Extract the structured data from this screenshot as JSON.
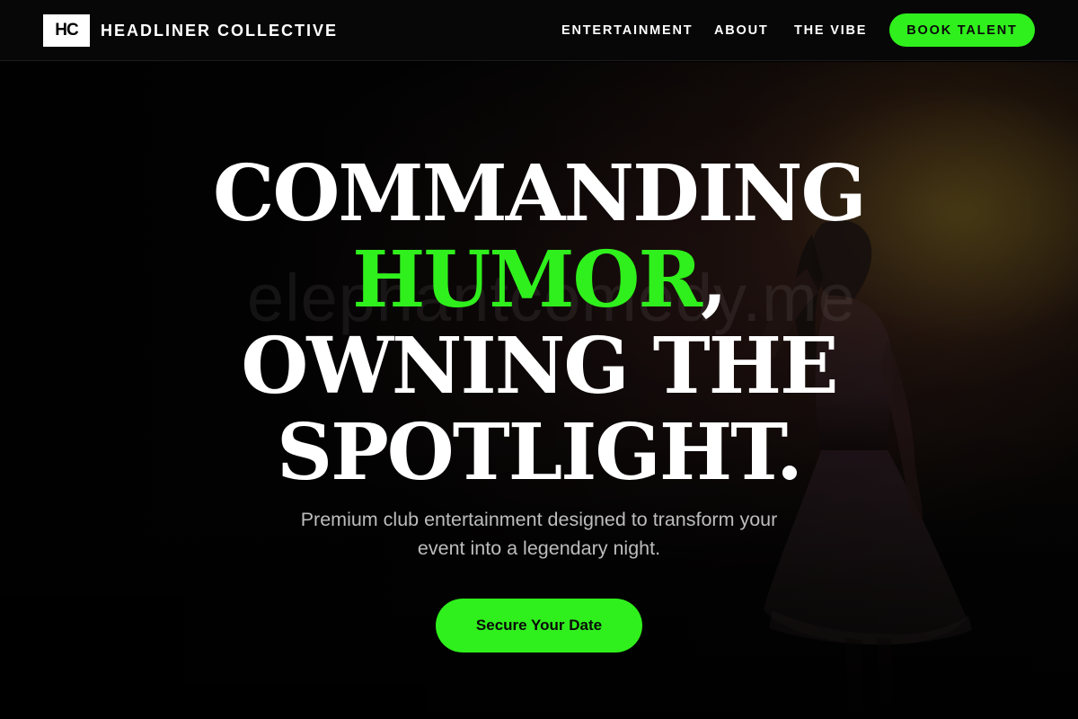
{
  "nav": {
    "logo_text": "HC",
    "brand_name": "HEADLINER COLLECTIVE",
    "links": [
      "ENTERTAINMENT",
      "ABOUT",
      "THE VIBE"
    ],
    "cta_label": "BOOK TALENT"
  },
  "hero": {
    "headline": {
      "line1": "COMMANDING",
      "accent": "HUMOR",
      "accent_suffix": ",",
      "line3": "OWNING THE",
      "line4": "SPOTLIGHT."
    },
    "subtext": {
      "line1": "Premium club entertainment designed to transform your",
      "line2": "event into a legendary night."
    },
    "cta_label": "Secure Your Date",
    "watermark": "elephantcomedy.me"
  },
  "colors": {
    "accent": "#2ff01c",
    "background": "#050505",
    "text": "#ffffff",
    "muted_text": "#bdbdbd"
  }
}
